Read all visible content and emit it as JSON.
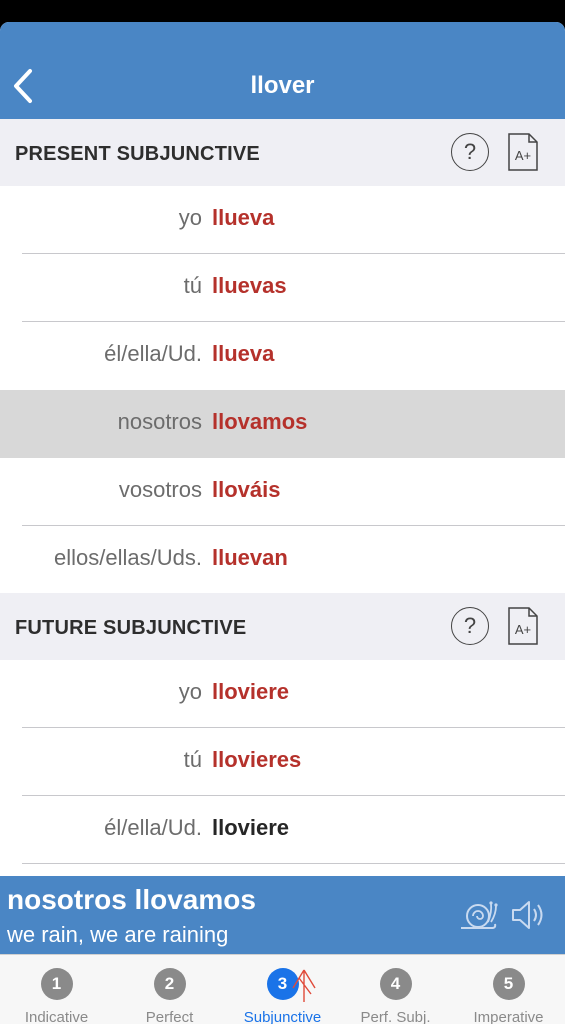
{
  "nav": {
    "title": "llover"
  },
  "sections": [
    {
      "title": "PRESENT SUBJUNCTIVE",
      "rows": [
        {
          "pronoun": "yo",
          "verb": "llueva",
          "irregular": true
        },
        {
          "pronoun": "tú",
          "verb": "lluevas",
          "irregular": true
        },
        {
          "pronoun": "él/ella/Ud.",
          "verb": "llueva",
          "irregular": true
        },
        {
          "pronoun": "nosotros",
          "verb": "llovamos",
          "irregular": true,
          "selected": true
        },
        {
          "pronoun": "vosotros",
          "verb": "llováis",
          "irregular": true
        },
        {
          "pronoun": "ellos/ellas/Uds.",
          "verb": "lluevan",
          "irregular": true
        }
      ]
    },
    {
      "title": "FUTURE SUBJUNCTIVE",
      "rows": [
        {
          "pronoun": "yo",
          "verb": "lloviere",
          "irregular": true
        },
        {
          "pronoun": "tú",
          "verb": "llovieres",
          "irregular": true
        },
        {
          "pronoun": "él/ella/Ud.",
          "verb": "lloviere",
          "irregular": false
        }
      ]
    }
  ],
  "help_glyph": "?",
  "font_glyph": "A+",
  "info": {
    "main": "nosotros llovamos",
    "sub": "we rain, we are raining"
  },
  "tabs": [
    {
      "num": "1",
      "label": "Indicative"
    },
    {
      "num": "2",
      "label": "Perfect"
    },
    {
      "num": "3",
      "label": "Subjunctive",
      "active": true
    },
    {
      "num": "4",
      "label": "Perf. Subj."
    },
    {
      "num": "5",
      "label": "Imperative"
    }
  ],
  "colors": {
    "accent": "#4a86c5",
    "irregular": "#b5312b",
    "active_tab": "#1a73e8"
  },
  "icons": {
    "back": "chevron-left-icon",
    "help": "question-circle-icon",
    "font": "font-size-document-icon",
    "slow": "snail-icon",
    "audio": "speaker-icon"
  }
}
